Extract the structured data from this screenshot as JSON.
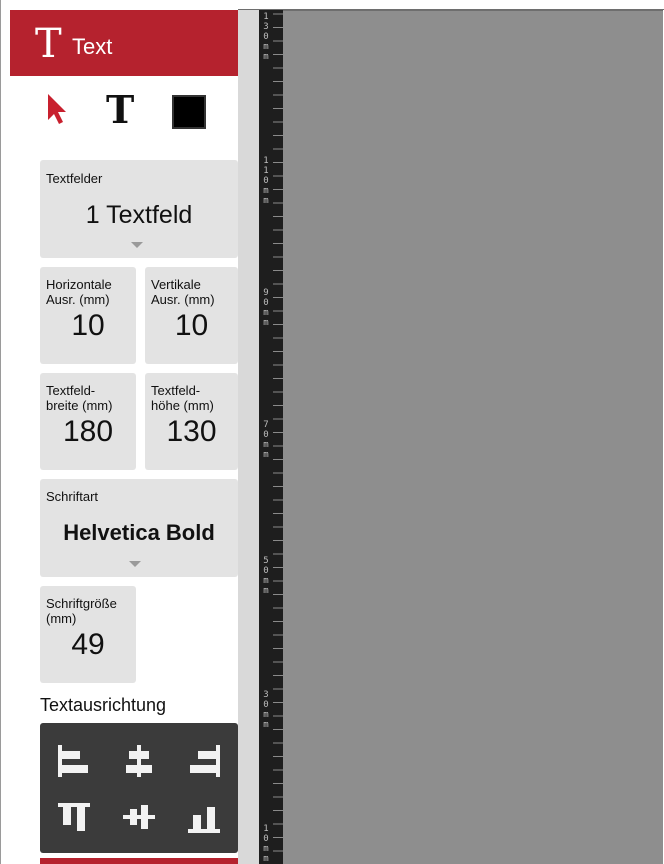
{
  "header": {
    "logo_letter": "T",
    "title": "Text",
    "accent_color": "#b5222e"
  },
  "tools": {
    "pointer_color": "#c8202e",
    "text_glyph": "T",
    "color_swatch": "#000000"
  },
  "fields": {
    "textfelder": {
      "label": "Textfelder",
      "value": "1 Textfeld"
    },
    "horizontal": {
      "label_line1": "Horizontale",
      "label_line2": "Ausr. (mm)",
      "value": "10"
    },
    "vertical": {
      "label_line1": "Vertikale",
      "label_line2": "Ausr. (mm)",
      "value": "10"
    },
    "width": {
      "label_line1": "Textfeld-",
      "label_line2": "breite (mm)",
      "value": "180"
    },
    "height": {
      "label_line1": "Textfeld-",
      "label_line2": "höhe (mm)",
      "value": "130"
    },
    "font": {
      "label": "Schriftart",
      "value": "Helvetica Bold"
    },
    "size": {
      "label_line1": "Schriftgröße",
      "label_line2": "(mm)",
      "value": "49"
    }
  },
  "alignment": {
    "title": "Textausrichtung",
    "buttons": [
      "align-left",
      "align-center",
      "align-right",
      "align-top",
      "align-middle",
      "align-bottom"
    ]
  },
  "ruler": {
    "labels": [
      "1",
      "3",
      "0",
      "m",
      "m",
      "1",
      "1",
      "0",
      "m",
      "m",
      "9",
      "0",
      "m",
      "m",
      "7",
      "0",
      "m",
      "m",
      "5",
      "0",
      "m",
      "m",
      "3",
      "0",
      "m",
      "m",
      "1",
      "0",
      "m",
      "m"
    ]
  }
}
